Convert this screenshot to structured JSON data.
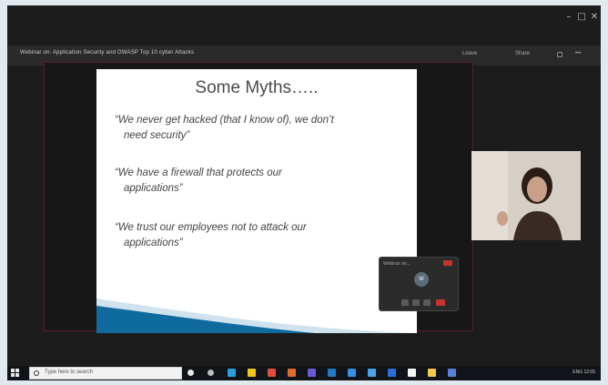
{
  "window": {
    "controls": [
      "–",
      "□",
      "✕"
    ],
    "meeting_title": "Webinar on: Application Security and OWASP Top 10 cyber Attacks",
    "bar_right_items": [
      "Leave",
      "Share",
      "•••"
    ]
  },
  "slide": {
    "title": "Some Myths…..",
    "myths": [
      {
        "line1": "“We never get hacked (that I know of), we don’t",
        "line2": "need security”"
      },
      {
        "line1": "“We have a firewall that protects our",
        "line2": "applications”"
      },
      {
        "line1": "“We trust our employees not to attack our",
        "line2": "applications”"
      }
    ],
    "colors": {
      "deco_blue": "#0f6a9e",
      "deco_light": "#cfe3ef"
    }
  },
  "floater": {
    "label": "Webinar on...",
    "avatar": "W"
  },
  "taskbar": {
    "search_placeholder": "Type here to search",
    "icons": [
      "cortana-icon",
      "task-view-icon",
      "edge-icon",
      "file-explorer-icon",
      "chrome-icon",
      "office-icon",
      "teams-icon",
      "store-icon",
      "mail-icon",
      "photos-icon",
      "app-icon",
      "powerpoint-icon",
      "settings-icon",
      "zoom-icon"
    ],
    "icon_colors": [
      "#e8e8e8",
      "#bdbdbd",
      "#2b9dd8",
      "#f0c419",
      "#e24c3c",
      "#e06b2a",
      "#6a5ad6",
      "#1f7bc4",
      "#3a8de0",
      "#47a4e6",
      "#2c6ed8",
      "#f4f4f4",
      "#f2c94c",
      "#5a7fd4"
    ],
    "tray_text": "ENG  12:05"
  }
}
